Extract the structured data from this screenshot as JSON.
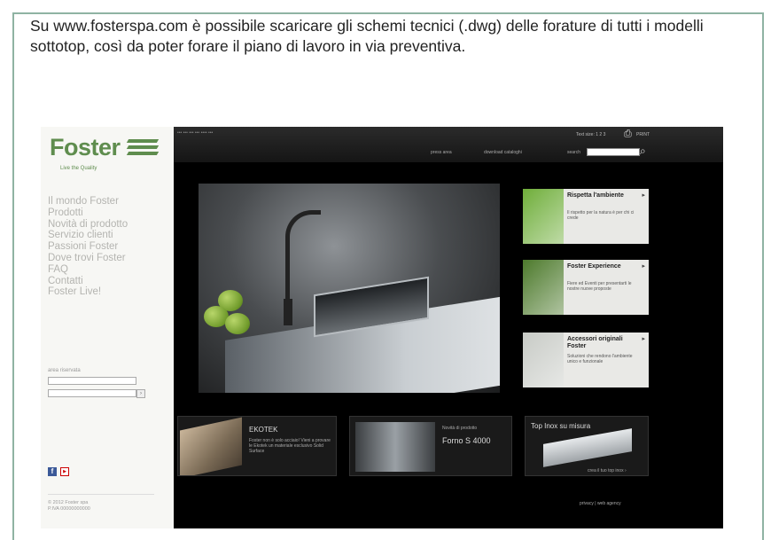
{
  "caption": "Su www.fosterspa.com è possibile scaricare gli schemi tecnici (.dwg) delle forature di tutti i modelli sottotop, così da poter forare il piano di lavoro in via preventiva.",
  "site": {
    "logo_text": "Foster",
    "tagline": "Live the Quality",
    "menu": [
      "Il mondo Foster",
      "Prodotti",
      "Novità di prodotto",
      "Servizio clienti",
      "Passioni Foster",
      "Dove trovi Foster",
      "FAQ",
      "Contatti",
      "Foster Live!"
    ],
    "sidebar_search_label": "area riservata",
    "copyright": "© 2012 Foster spa",
    "vat": "P.IVA 00000000000"
  },
  "topbar": {
    "breadcrumb": "•••  •••  •••  •••  ••••  •••",
    "text_size": "Text size: 1 2 3",
    "print_label": "PRINT",
    "nav": [
      "press area",
      "download cataloghi"
    ],
    "search_label": "search"
  },
  "promos": [
    {
      "title": "Rispetta l'ambiente",
      "text": "Il rispetto per la natura è per chi ci crede",
      "color": "#6fae3a"
    },
    {
      "title": "Foster Experience",
      "text": "Fiere ed Eventi per presentarti le nostre nuove proposte",
      "color": "#4d7a2c"
    },
    {
      "title": "Accessori originali Foster",
      "text": "Soluzioni che rendono l'ambiente unico e funzionale",
      "color": "#c8cbc6"
    }
  ],
  "bottom": {
    "ekotek_title": "EKOTEK",
    "ekotek_text": "Foster non è solo acciaio! Vieni a provare le Ekotek un materiale esclusivo Solid Surface",
    "forno_label": "Novità di prodotto",
    "forno_title": "Forno S 4000",
    "topinox_title": "Top Inox su misura",
    "topinox_link": "crea il tuo top inox ›"
  },
  "footer": {
    "privacy": "privacy",
    "credits": "web agency"
  }
}
